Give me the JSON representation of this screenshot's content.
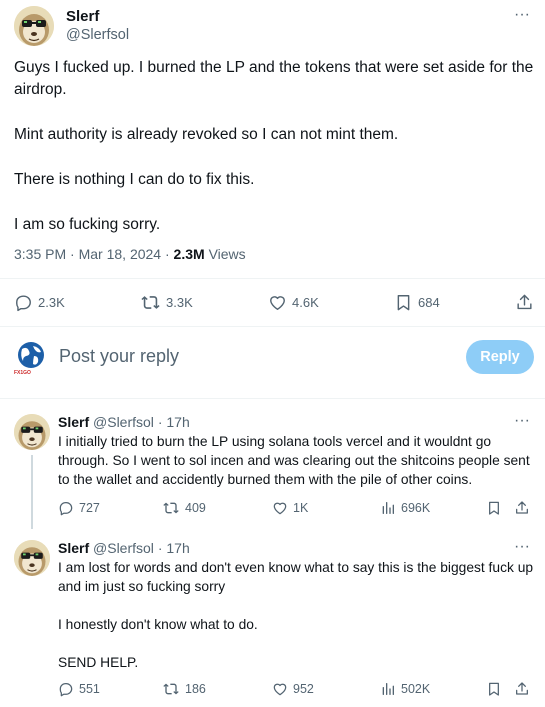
{
  "main_tweet": {
    "name": "Slerf",
    "handle": "@Slerfsol",
    "more": "···",
    "paragraphs": [
      "Guys I fucked up. I burned the LP and the tokens that were set aside for the airdrop.",
      "Mint authority is already revoked so I can not mint them.",
      "There is nothing I can do to fix this.",
      "I am so fucking sorry."
    ],
    "time": "3:35 PM",
    "date": "Mar 18, 2024",
    "views_count": "2.3M",
    "views_label": "Views",
    "stats": {
      "replies": "2.3K",
      "reposts": "3.3K",
      "likes": "4.6K",
      "bookmarks": "684"
    }
  },
  "composer": {
    "avatar_label": "FX1GO",
    "placeholder": "Post your reply",
    "button_label": "Reply"
  },
  "replies": [
    {
      "name": "Slerf",
      "handle": "@Slerfsol",
      "age": "17h",
      "paragraphs": [
        "I initially tried to burn the LP using solana tools vercel and it wouldnt go through. So I went to sol incen and was clearing out the shitcoins people sent to the wallet and accidently burned them with the pile of other coins."
      ],
      "stats": {
        "replies": "727",
        "reposts": "409",
        "likes": "1K",
        "views": "696K"
      }
    },
    {
      "name": "Slerf",
      "handle": "@Slerfsol",
      "age": "17h",
      "paragraphs": [
        "I am lost for words and don't even know what to say this is the biggest fuck up and im just so fucking sorry",
        "I honestly don't know what to do.",
        "SEND HELP."
      ],
      "stats": {
        "replies": "551",
        "reposts": "186",
        "likes": "952",
        "views": "502K"
      }
    }
  ],
  "colors": {
    "text": "#0f1419",
    "muted": "#536471",
    "reply_button": "#8ecdf7",
    "divider": "#eff3f4"
  }
}
